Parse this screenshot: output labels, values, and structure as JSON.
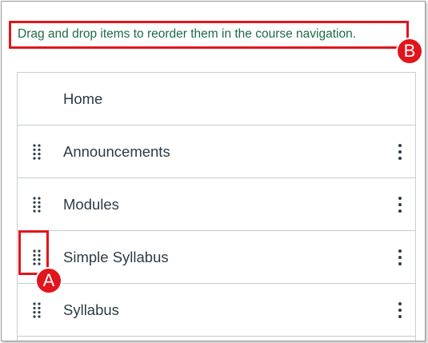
{
  "instruction": "Drag and drop items to reorder them in the course navigation.",
  "callouts": {
    "a": "A",
    "b": "B"
  },
  "nav_items": [
    {
      "label": "Home"
    },
    {
      "label": "Announcements"
    },
    {
      "label": "Modules"
    },
    {
      "label": "Simple Syllabus"
    },
    {
      "label": "Syllabus"
    }
  ],
  "colors": {
    "instruction_text": "#1d6b45",
    "callout_red": "#e0161c",
    "label_text": "#2d3b45",
    "border": "#c7cdd1"
  }
}
